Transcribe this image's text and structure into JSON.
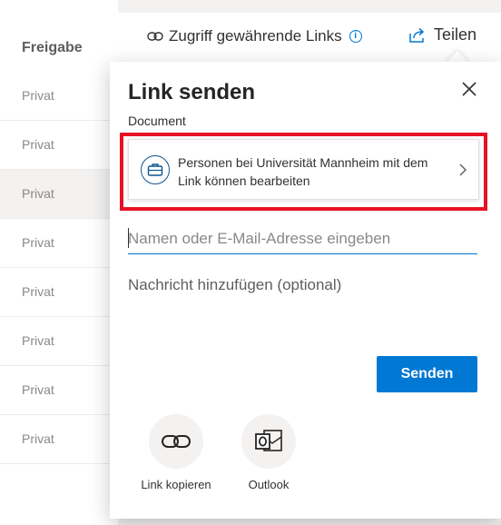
{
  "list": {
    "header": "Freigabe",
    "rows": [
      {
        "status": "Privat"
      },
      {
        "status": "Privat"
      },
      {
        "status": "Privat"
      },
      {
        "status": "Privat"
      },
      {
        "status": "Privat"
      },
      {
        "status": "Privat"
      },
      {
        "status": "Privat"
      },
      {
        "status": "Privat"
      }
    ]
  },
  "topbar": {
    "access_links": "Zugriff gewährende Links",
    "share_label": "Teilen"
  },
  "dialog": {
    "title": "Link senden",
    "subtitle": "Document",
    "permission_text": "Personen bei Universität Mannheim mit dem Link können bearbeiten",
    "recipient_placeholder": "Namen oder E-Mail-Adresse eingeben",
    "message_placeholder": "Nachricht hinzufügen (optional)",
    "send_label": "Senden",
    "actions": [
      {
        "label": "Link kopieren",
        "icon": "link-icon"
      },
      {
        "label": "Outlook",
        "icon": "outlook-icon"
      }
    ]
  },
  "colors": {
    "accent": "#0078d4",
    "highlight": "#e81123",
    "icon_dark": "#0f548c"
  }
}
